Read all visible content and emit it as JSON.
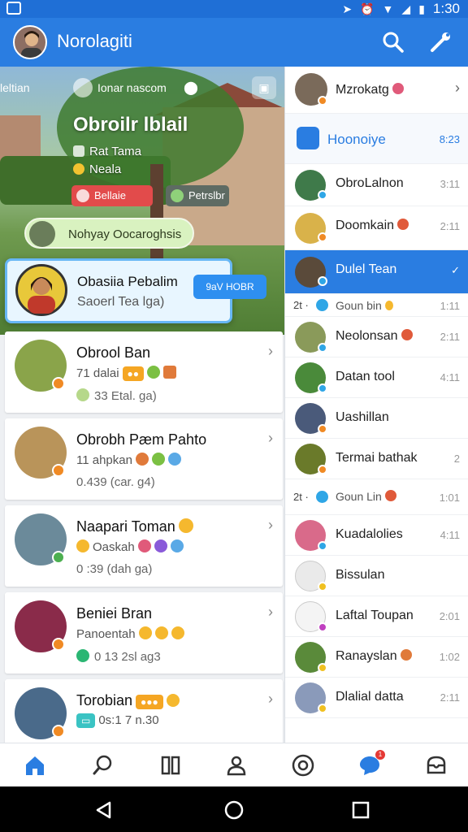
{
  "status_bar": {
    "time": "1:30"
  },
  "app_bar": {
    "title": "Norolagiti"
  },
  "hero": {
    "top_label": "leltian",
    "chip": "Ionar nascom",
    "title": "Obroilr lblail",
    "line1": "Rat Tama",
    "line2": "Neala",
    "button_red": "Bellaie",
    "button_gray": "Petrslbr",
    "tag": "Nohyay Oocaroghsis"
  },
  "featured": {
    "name": "Obasiia Pebalim",
    "sub": "Saoerl Tea lga)",
    "button": "9aV HOBR"
  },
  "left_list": [
    {
      "name": "Obrool Ban",
      "sub": "71 dalai",
      "meta": "33 Etal. ga)",
      "avatar_color": "#8aa44a",
      "badge_color": "#f08a24"
    },
    {
      "name": "Obrobh Pæm Pahto",
      "sub": "11 ahpkan",
      "meta": "0.439 (car. g4)",
      "avatar_color": "#b9945a",
      "badge_color": "#f08a24"
    },
    {
      "name": "Naapari Toman",
      "sub": "Oaskah",
      "meta": "0 :39 (dah ga)",
      "avatar_color": "#6b8a9a",
      "badge_color": "#4caf50"
    },
    {
      "name": "Beniei Bran",
      "sub": "Panoentah",
      "meta": "0 13 2sl ag3",
      "avatar_color": "#8a2b4a",
      "badge_color": "#f08a24"
    },
    {
      "name": "Torobian",
      "sub": "0s:1 7 n.30",
      "meta": "",
      "avatar_color": "#4a6a8a",
      "badge_color": "#f08a24"
    }
  ],
  "right_list": [
    {
      "type": "contact",
      "label": "Mzrokatg",
      "time": "›",
      "avatar_color": "#7a6a5a",
      "badge_color": "#f08a24"
    },
    {
      "type": "head",
      "label": "Hoonoiye",
      "time": "8:23"
    },
    {
      "type": "contact",
      "label": "ObroLalnon",
      "time": "3:11",
      "avatar_color": "#3f7a4a",
      "badge_color": "#2fa6e6"
    },
    {
      "type": "contact",
      "label": "Doomkain",
      "time": "2:11",
      "avatar_color": "#d9b24a",
      "badge_color": "#f08a24"
    },
    {
      "type": "selected",
      "label": "Dulel Tean",
      "time": "✓",
      "avatar_color": "#5a4a3a",
      "badge_color": "#2fa6e6"
    },
    {
      "type": "small",
      "num": "2t ·",
      "label": "Goun bin",
      "time": "1:11"
    },
    {
      "type": "contact",
      "label": "Neolonsan",
      "time": "2:11",
      "avatar_color": "#8a9a5a",
      "badge_color": "#2fa6e6"
    },
    {
      "type": "contact",
      "label": "Datan tool",
      "time": "4:11",
      "avatar_color": "#4a8a3a",
      "badge_color": "#2fa6e6"
    },
    {
      "type": "contact",
      "label": "Uashillan",
      "time": "",
      "avatar_color": "#4a5a7a",
      "badge_color": "#f08a24"
    },
    {
      "type": "contact",
      "label": "Termai bathak",
      "time": "2",
      "avatar_color": "#6a7a2a",
      "badge_color": "#f08a24"
    },
    {
      "type": "small",
      "num": "2t ·",
      "label": "Goun Lin",
      "time": "1:01"
    },
    {
      "type": "contact",
      "label": "Kuadalolies",
      "time": "4:11",
      "avatar_color": "#d96a8a",
      "badge_color": "#2fa6e6"
    },
    {
      "type": "contact",
      "label": "Bissulan",
      "time": "",
      "avatar_color": "#eaeaea",
      "badge_color": "#f0c020"
    },
    {
      "type": "contact",
      "label": "Laftal Toupan",
      "time": "2:01",
      "avatar_color": "#f4f4f4",
      "badge_color": "#c040c0"
    },
    {
      "type": "contact",
      "label": "Ranayslan",
      "time": "1:02",
      "avatar_color": "#5a8a3a",
      "badge_color": "#f0c020"
    },
    {
      "type": "contact",
      "label": "Dlalial datta",
      "time": "2:11",
      "avatar_color": "#8a9aba",
      "badge_color": "#f0c020"
    }
  ],
  "bottom_nav": {
    "chat_badge": "1"
  },
  "colors": {
    "primary": "#2a7de1",
    "accent": "#f08a24"
  }
}
